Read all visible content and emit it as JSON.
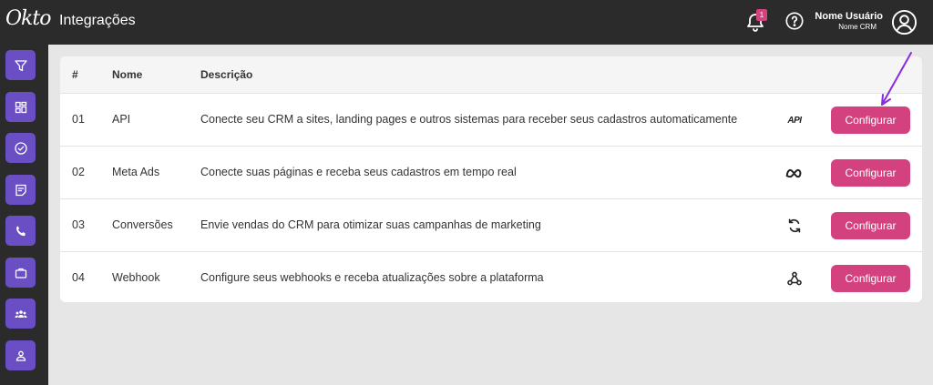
{
  "header": {
    "logo_text": "Okto",
    "title": "Integrações",
    "notification_count": "1",
    "user_name": "Nome Usuário",
    "user_crm": "Nome CRM",
    "icons": [
      "bell-icon",
      "help-icon",
      "user-avatar-icon"
    ]
  },
  "sidebar": {
    "items": [
      {
        "icon": "filter-icon"
      },
      {
        "icon": "dashboard-icon"
      },
      {
        "icon": "check-circle-icon"
      },
      {
        "icon": "note-icon"
      },
      {
        "icon": "phone-icon"
      },
      {
        "icon": "briefcase-icon"
      },
      {
        "icon": "team-icon"
      },
      {
        "icon": "user-icon"
      }
    ]
  },
  "table": {
    "columns": [
      "#",
      "Nome",
      "Descrição"
    ],
    "rows": [
      {
        "num": "01",
        "name": "API",
        "description": "Conecte seu CRM a sites, landing pages e outros sistemas para receber seus cadastros automaticamente",
        "icon": "api-icon",
        "icon_text": "API",
        "button": "Configurar"
      },
      {
        "num": "02",
        "name": "Meta Ads",
        "description": "Conecte suas páginas e receba seus cadastros em tempo real",
        "icon": "meta-icon",
        "button": "Configurar"
      },
      {
        "num": "03",
        "name": "Conversões",
        "description": "Envie vendas do CRM para otimizar suas campanhas de marketing",
        "icon": "sync-icon",
        "button": "Configurar"
      },
      {
        "num": "04",
        "name": "Webhook",
        "description": "Configure seus webhooks e receba atualizações sobre a plataforma",
        "icon": "webhook-icon",
        "button": "Configurar"
      }
    ]
  },
  "colors": {
    "topbar": "#2b2b2b",
    "sidebar_button": "#6a4fc4",
    "primary_button": "#d4417f",
    "annotation_arrow": "#8a2be2"
  }
}
